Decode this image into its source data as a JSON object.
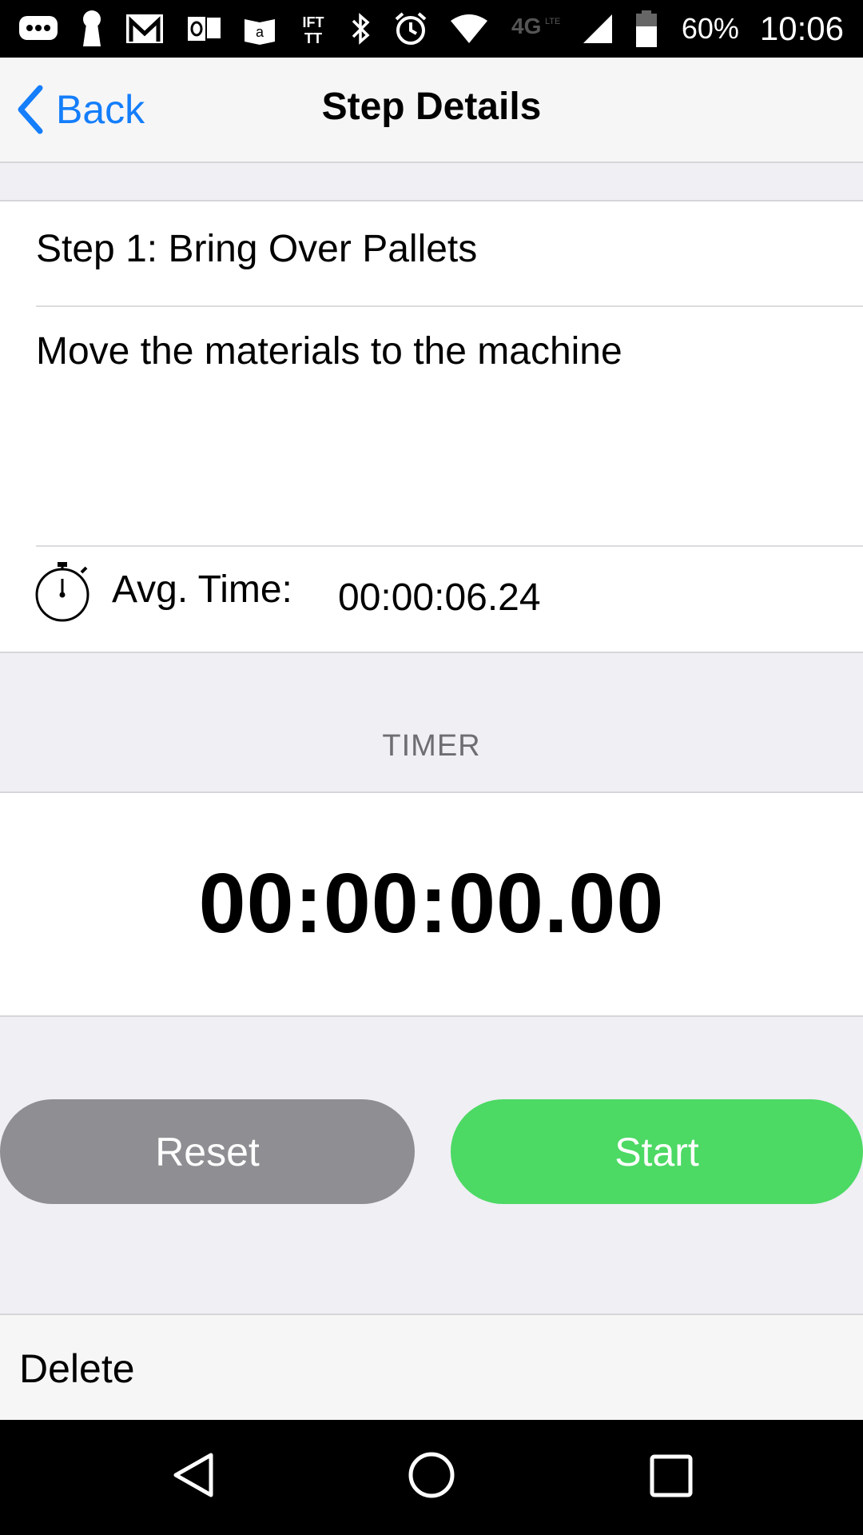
{
  "status_bar": {
    "icons": [
      "messages-icon",
      "keyhole-icon",
      "gmail-icon",
      "outlook-icon",
      "amazon-kindle-icon",
      "ifttt-icon",
      "bluetooth-icon",
      "alarm-icon",
      "wifi-icon",
      "4g-lte-icon",
      "signal-icon",
      "battery-icon"
    ],
    "battery": "60%",
    "time": "10:06"
  },
  "nav": {
    "back_label": "Back",
    "title": "Step Details"
  },
  "step": {
    "title": "Step 1: Bring Over Pallets",
    "description": "Move the materials to the machine",
    "avg_label": "Avg. Time:",
    "avg_value": "00:00:06.24"
  },
  "timer": {
    "header": "TIMER",
    "display": "00:00:00.00"
  },
  "buttons": {
    "reset": "Reset",
    "start": "Start"
  },
  "delete_label": "Delete",
  "colors": {
    "accent": "#147efb",
    "start": "#4cd964",
    "reset": "#8e8e93",
    "background": "#efeff4"
  },
  "android_nav": [
    "back-triangle-icon",
    "home-circle-icon",
    "recents-square-icon"
  ]
}
